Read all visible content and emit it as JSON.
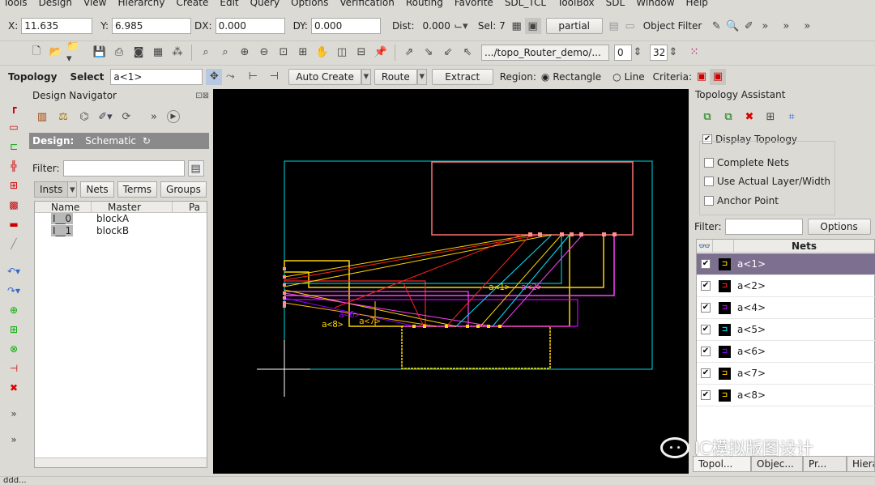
{
  "menu": [
    "Tools",
    "Design",
    "View",
    "Hierarchy",
    "Create",
    "Edit",
    "Query",
    "Options",
    "Verification",
    "Routing",
    "Favorite",
    "SDL_TCL",
    "ToolBox",
    "SDL",
    "Window",
    "Help"
  ],
  "coords": {
    "x_label": "X:",
    "x_value": "11.635",
    "y_label": "Y:",
    "y_value": "6.985",
    "dx_label": "DX:",
    "dx_value": "0.000",
    "dy_label": "DY:",
    "dy_value": "0.000",
    "dist_label": "Dist:",
    "dist_value": "0.000",
    "sel_label": "Sel: 7",
    "partial_label": "partial",
    "object_filter": "Object Filter"
  },
  "toolbar2": {
    "path_value": ".../topo_Router_demo/...",
    "level_start": "0",
    "level_end": "32"
  },
  "toolbar3": {
    "topology_label": "Topology",
    "select_label": "Select",
    "select_value": "a<1>",
    "auto_create": "Auto Create",
    "route": "Route",
    "extract": "Extract",
    "region_label": "Region:",
    "rectangle": "Rectangle",
    "line": "Line",
    "criteria": "Criteria:"
  },
  "navigator": {
    "title": "Design Navigator",
    "design_label": "Design:",
    "design_value": "Schematic",
    "filter_label": "Filter:",
    "tabs": [
      "Insts",
      "Nets",
      "Terms",
      "Groups"
    ],
    "columns": [
      "Name",
      "Master",
      "Pa"
    ],
    "rows": [
      {
        "name": "I__0",
        "master": "blockA"
      },
      {
        "name": "I__1",
        "master": "blockB"
      }
    ]
  },
  "canvas_labels": {
    "l1": "a<8>",
    "l2": "a<7>",
    "l3": "a<6>",
    "l4": "a<1>",
    "l5": "a<2>"
  },
  "assistant": {
    "title": "Topology Assistant",
    "display_topology": "Display Topology",
    "complete_nets": "Complete Nets",
    "use_actual": "Use Actual Layer/Width",
    "anchor_point": "Anchor Point",
    "filter_label": "Filter:",
    "options": "Options",
    "nets_header": "Nets",
    "nets": [
      {
        "name": "a<1>",
        "color": "#ffd400",
        "selected": true
      },
      {
        "name": "a<2>",
        "color": "#ff2020",
        "selected": false
      },
      {
        "name": "a<4>",
        "color": "#d000ff",
        "selected": false
      },
      {
        "name": "a<5>",
        "color": "#00e8ff",
        "selected": false
      },
      {
        "name": "a<6>",
        "color": "#8a00ff",
        "selected": false
      },
      {
        "name": "a<7>",
        "color": "#ffb000",
        "selected": false
      },
      {
        "name": "a<8>",
        "color": "#ffd000",
        "selected": false
      }
    ],
    "bottom_tabs": [
      "Topol...",
      "Objec...",
      "Pr...",
      "Hiera"
    ]
  },
  "watermark": "IC模拟版图设计",
  "status": "ddd..."
}
